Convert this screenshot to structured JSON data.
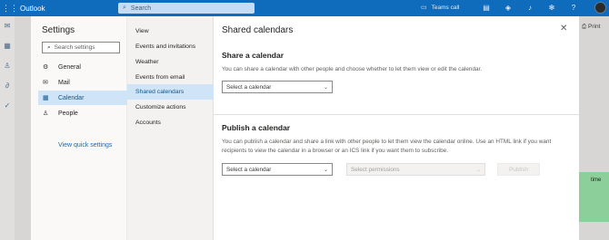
{
  "topbar": {
    "brand": "Outlook",
    "search_placeholder": "Search",
    "teams_call": "Teams call"
  },
  "background": {
    "print_label": "Print",
    "time_label": "time"
  },
  "settings": {
    "title": "Settings",
    "search_placeholder": "Search settings",
    "categories": [
      {
        "label": "General",
        "icon": "gear-icon"
      },
      {
        "label": "Mail",
        "icon": "mail-icon"
      },
      {
        "label": "Calendar",
        "icon": "calendar-icon"
      },
      {
        "label": "People",
        "icon": "people-icon"
      }
    ],
    "quick_link": "View quick settings",
    "subcategories": [
      "View",
      "Events and invitations",
      "Weather",
      "Events from email",
      "Shared calendars",
      "Customize actions",
      "Accounts"
    ]
  },
  "main": {
    "title": "Shared calendars",
    "share": {
      "heading": "Share a calendar",
      "description": "You can share a calendar with other people and choose whether to let them view or edit the calendar.",
      "select_placeholder": "Select a calendar"
    },
    "publish": {
      "heading": "Publish a calendar",
      "description": "You can publish a calendar and share a link with other people to let them view the calendar online. Use an HTML link if you want recipients to view the calendar in a browser or an ICS link if you want them to subscribe.",
      "select_placeholder": "Select a calendar",
      "permissions_placeholder": "Select permissions",
      "publish_button": "Publish"
    }
  },
  "colors": {
    "accent": "#0f6cbd",
    "selected_bg": "#cfe4f7",
    "selected_text": "#0f548c"
  }
}
